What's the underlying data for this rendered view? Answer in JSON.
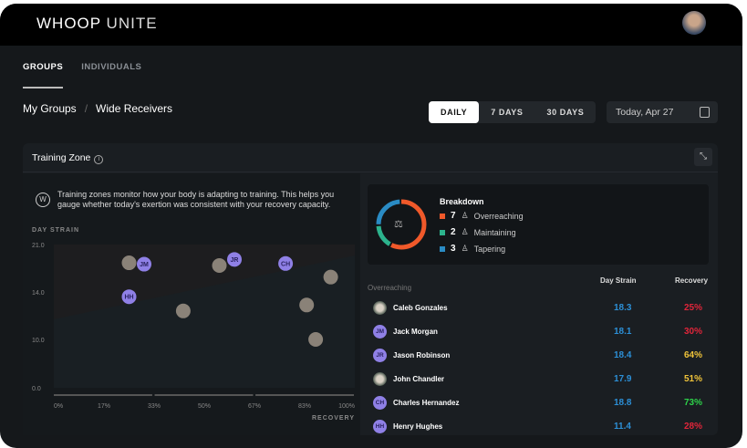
{
  "app": {
    "brand": "WHOOP",
    "product": "UNITE"
  },
  "tabs": [
    {
      "label": "GROUPS",
      "active": true
    },
    {
      "label": "INDIVIDUALS",
      "active": false
    }
  ],
  "breadcrumb": {
    "root": "My Groups",
    "separator": "/",
    "current": "Wide Receivers"
  },
  "range": {
    "options": [
      "DAILY",
      "7 DAYS",
      "30 DAYS"
    ],
    "selected": "DAILY"
  },
  "date": {
    "value": "Today, Apr 27"
  },
  "card": {
    "title": "Training Zone",
    "info": "i",
    "description": "Training zones monitor how your body is adapting to training. This helps you gauge whether today's exertion was consistent with your recovery capacity.",
    "w_icon": "W"
  },
  "chart_data": {
    "type": "scatter",
    "ylabel": "DAY STRAIN",
    "xlabel": "RECOVERY",
    "yticks": [
      {
        "v": 21,
        "label": "21.0"
      },
      {
        "v": 14,
        "label": "14.0"
      },
      {
        "v": 10,
        "label": "10.0"
      },
      {
        "v": 0,
        "label": "0.0"
      }
    ],
    "xticks": [
      "0%",
      "17%",
      "33%",
      "50%",
      "67%",
      "83%",
      "100%"
    ],
    "xlim": [
      0,
      100
    ],
    "ylim": [
      0,
      21
    ],
    "points": [
      {
        "initials": "",
        "photo": true,
        "recovery": 25,
        "strain": 18.3
      },
      {
        "initials": "JM",
        "photo": false,
        "recovery": 30,
        "strain": 18.1
      },
      {
        "initials": "JR",
        "photo": false,
        "recovery": 60,
        "strain": 18.8
      },
      {
        "initials": "",
        "photo": true,
        "recovery": 55,
        "strain": 17.9
      },
      {
        "initials": "CH",
        "photo": false,
        "recovery": 77,
        "strain": 18.2
      },
      {
        "initials": "",
        "photo": true,
        "recovery": 92,
        "strain": 16.2
      },
      {
        "initials": "HH",
        "photo": false,
        "recovery": 25,
        "strain": 13.6
      },
      {
        "initials": "",
        "photo": true,
        "recovery": 43,
        "strain": 12.4
      },
      {
        "initials": "",
        "photo": true,
        "recovery": 84,
        "strain": 12.9
      },
      {
        "initials": "",
        "photo": true,
        "recovery": 87,
        "strain": 10.0
      }
    ]
  },
  "breakdown": {
    "title": "Breakdown",
    "items": [
      {
        "count": "7",
        "label": "Overreaching",
        "color": "#f0592a"
      },
      {
        "count": "2",
        "label": "Maintaining",
        "color": "#2cb38d"
      },
      {
        "count": "3",
        "label": "Tapering",
        "color": "#2a8bc4"
      }
    ]
  },
  "table": {
    "section": "Overreaching",
    "col_strain": "Day Strain",
    "col_recovery": "Recovery",
    "rows": [
      {
        "initials": "",
        "photo": true,
        "name": "Caleb Gonzales",
        "strain": "18.3",
        "recovery": "25%",
        "color": "#e0253a"
      },
      {
        "initials": "JM",
        "photo": false,
        "name": "Jack Morgan",
        "strain": "18.1",
        "recovery": "30%",
        "color": "#e0253a"
      },
      {
        "initials": "JR",
        "photo": false,
        "name": "Jason Robinson",
        "strain": "18.4",
        "recovery": "64%",
        "color": "#f0c43a"
      },
      {
        "initials": "",
        "photo": true,
        "name": "John Chandler",
        "strain": "17.9",
        "recovery": "51%",
        "color": "#f0c43a"
      },
      {
        "initials": "CH",
        "photo": false,
        "name": "Charles Hernandez",
        "strain": "18.8",
        "recovery": "73%",
        "color": "#2dd34a"
      },
      {
        "initials": "HH",
        "photo": false,
        "name": "Henry Hughes",
        "strain": "11.4",
        "recovery": "28%",
        "color": "#e0253a"
      }
    ]
  }
}
